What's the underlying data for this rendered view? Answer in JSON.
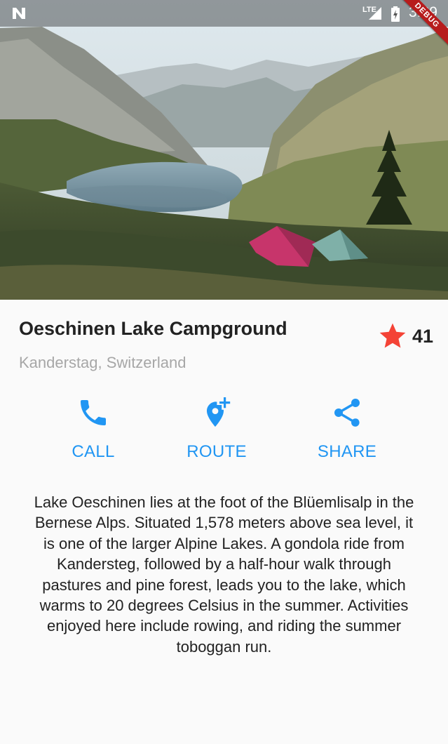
{
  "status_bar": {
    "network": "LTE",
    "time": "3:29",
    "debug_banner": "DEBUG"
  },
  "hero": {
    "image": "lake-campground-photo"
  },
  "title_section": {
    "name": "Oeschinen Lake Campground",
    "location": "Kanderstag, Switzerland",
    "favorite_count": "41",
    "favorite_color": "#f44336"
  },
  "actions": [
    {
      "label": "CALL",
      "icon": "phone-icon"
    },
    {
      "label": "ROUTE",
      "icon": "add-location-icon"
    },
    {
      "label": "SHARE",
      "icon": "share-icon"
    }
  ],
  "accent_color": "#2196f3",
  "description": "Lake Oeschinen lies at the foot of the Blüemlisalp in the Bernese Alps. Situated 1,578 meters above sea level, it is one of the larger Alpine Lakes. A gondola ride from Kandersteg, followed by a half-hour walk through pastures and pine forest, leads you to the lake, which warms to 20 degrees Celsius in the summer. Activities enjoyed here include rowing, and riding the summer toboggan run."
}
